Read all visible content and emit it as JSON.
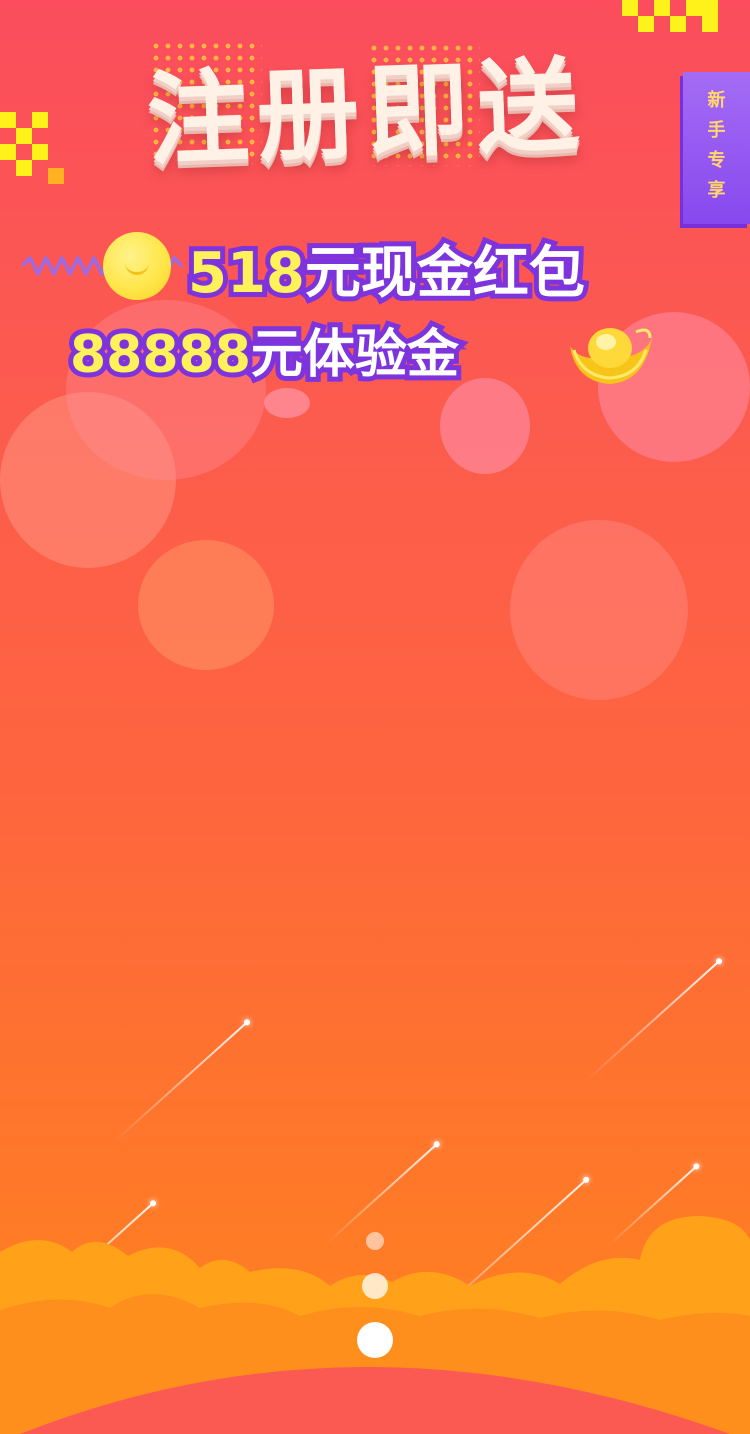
{
  "promo": {
    "title": "注册即送",
    "badge_chars": [
      "新",
      "手",
      "专",
      "享"
    ],
    "line1": {
      "highlight": "518",
      "rest": "元现金红包"
    },
    "line2": {
      "highlight": "88888",
      "rest": "元体验金"
    }
  },
  "pager": {
    "count": 3,
    "active_index": 2
  },
  "colors": {
    "background_top": "#fb4d5d",
    "background_bottom": "#ff8420",
    "highlight_yellow": "#fff15a",
    "outline_purple": "#7d34dd",
    "badge_purple": "#8848ee",
    "badge_text": "#ffd76a",
    "cloud_orange": "#ffa21a"
  },
  "icons": [
    "checker-pattern-icon",
    "coin-icon",
    "zigzag-icon",
    "gold-ingot-icon",
    "meteor-icon",
    "cloud-icon"
  ]
}
